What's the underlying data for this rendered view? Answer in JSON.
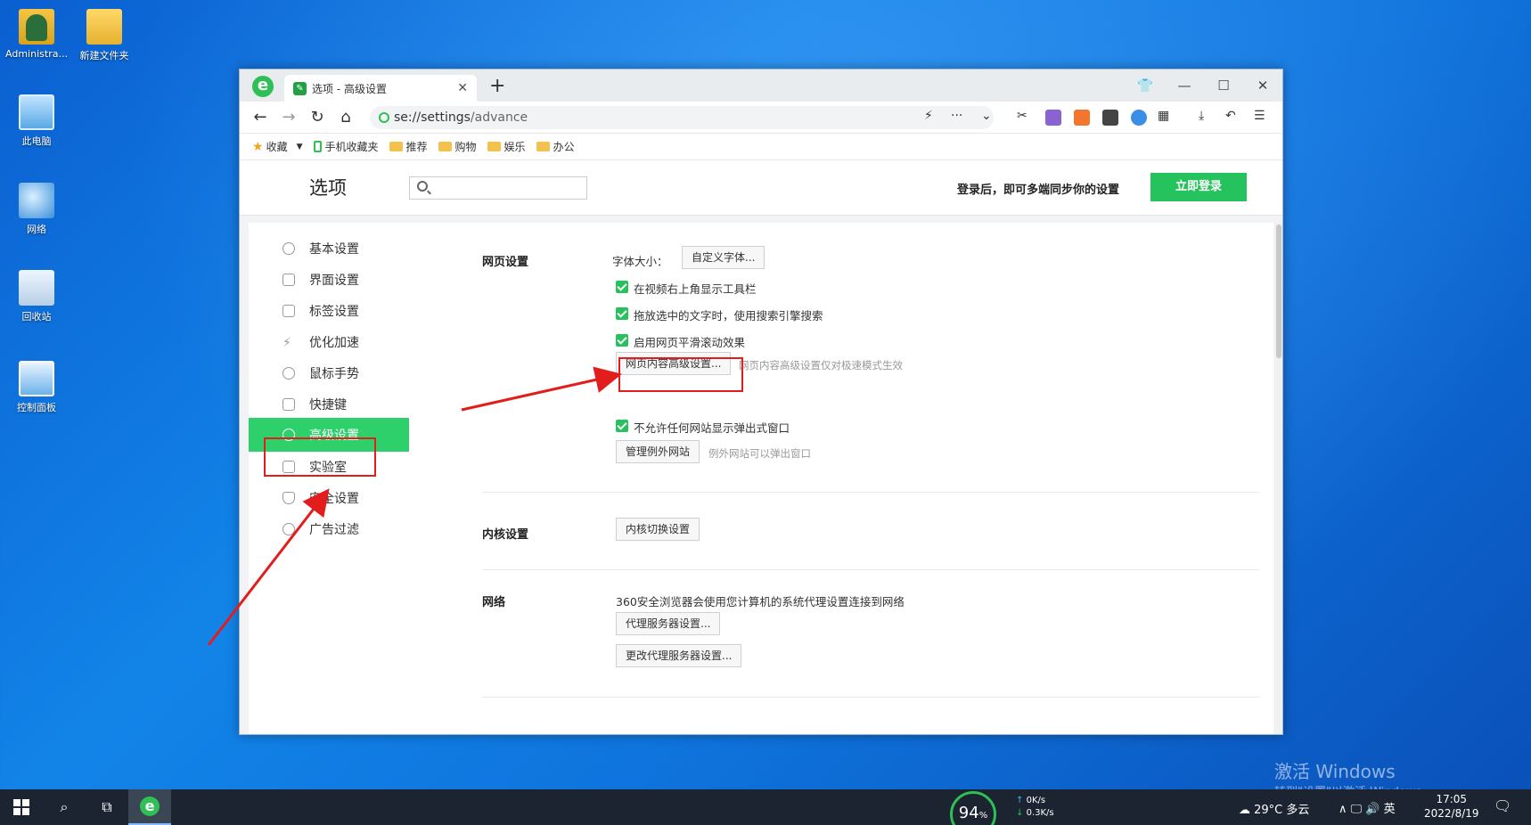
{
  "desktop": {
    "icons": [
      {
        "label": "Administra..."
      },
      {
        "label": "新建文件夹"
      },
      {
        "label": "此电脑"
      },
      {
        "label": "网络"
      },
      {
        "label": "回收站"
      },
      {
        "label": "控制面板"
      }
    ]
  },
  "browser": {
    "tab_title": "选项 - 高级设置",
    "tab_close": "✕",
    "new_tab": "+",
    "address_scheme": "se://",
    "address_path": "settings",
    "address_rest": "/advance",
    "bookmarks": [
      "收藏",
      "手机收藏夹",
      "推荐",
      "购物",
      "娱乐",
      "办公"
    ]
  },
  "settings": {
    "page_title": "选项",
    "search_placeholder": "",
    "sync_text": "登录后，即可多端同步你的设置",
    "login_button": "立即登录",
    "sidebar": [
      {
        "label": "基本设置"
      },
      {
        "label": "界面设置"
      },
      {
        "label": "标签设置"
      },
      {
        "label": "优化加速"
      },
      {
        "label": "鼠标手势"
      },
      {
        "label": "快捷键"
      },
      {
        "label": "高级设置"
      },
      {
        "label": "实验室"
      },
      {
        "label": "安全设置"
      },
      {
        "label": "广告过滤"
      }
    ],
    "web": {
      "title": "网页设置",
      "font_size_label": "字体大小：",
      "custom_font_button": "自定义字体...",
      "check1": "在视频右上角显示工具栏",
      "check2": "拖放选中的文字时，使用搜索引擎搜索",
      "check3": "启用网页平滑滚动效果",
      "advanced_button": "网页内容高级设置...",
      "advanced_hint": "网页内容高级设置仅对极速模式生效",
      "check4": "不允许任何网站显示弹出式窗口",
      "exceptions_button": "管理例外网站",
      "exceptions_hint": "例外网站可以弹出窗口"
    },
    "kernel": {
      "title": "内核设置",
      "switch_button": "内核切换设置"
    },
    "network": {
      "title": "网络",
      "desc": "360安全浏览器会使用您计算机的系统代理设置连接到网络",
      "proxy_button": "代理服务器设置...",
      "change_proxy_button": "更改代理服务器设置..."
    }
  },
  "taskbar": {
    "cpu": "94",
    "cpu_unit": "%",
    "up_speed": "0K/s",
    "down_speed": "0.3K/s",
    "weather": "29°C  多云",
    "ime": "英",
    "time": "17:05",
    "date": "2022/8/19"
  },
  "watermark": {
    "line1": "激活 Windows",
    "line2": "转到\"设置\"以激活 Windows。"
  }
}
